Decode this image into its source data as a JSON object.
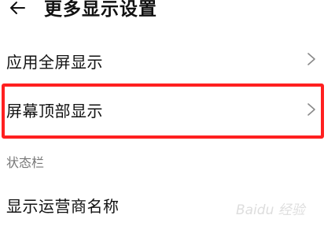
{
  "header": {
    "back_icon": "back-arrow-icon",
    "title": "更多显示设置"
  },
  "settings": {
    "items": [
      {
        "label": "应用全屏显示",
        "icon": "chevron-right-icon"
      },
      {
        "label": "屏幕顶部显示",
        "icon": "chevron-right-icon",
        "highlighted": true
      }
    ]
  },
  "status_bar_section": {
    "header": "状态栏",
    "items": [
      {
        "label": "显示运营商名称"
      }
    ]
  },
  "annotation": {
    "highlight_color": "#ff2020"
  },
  "watermark": {
    "text": "Baidu 经验"
  }
}
